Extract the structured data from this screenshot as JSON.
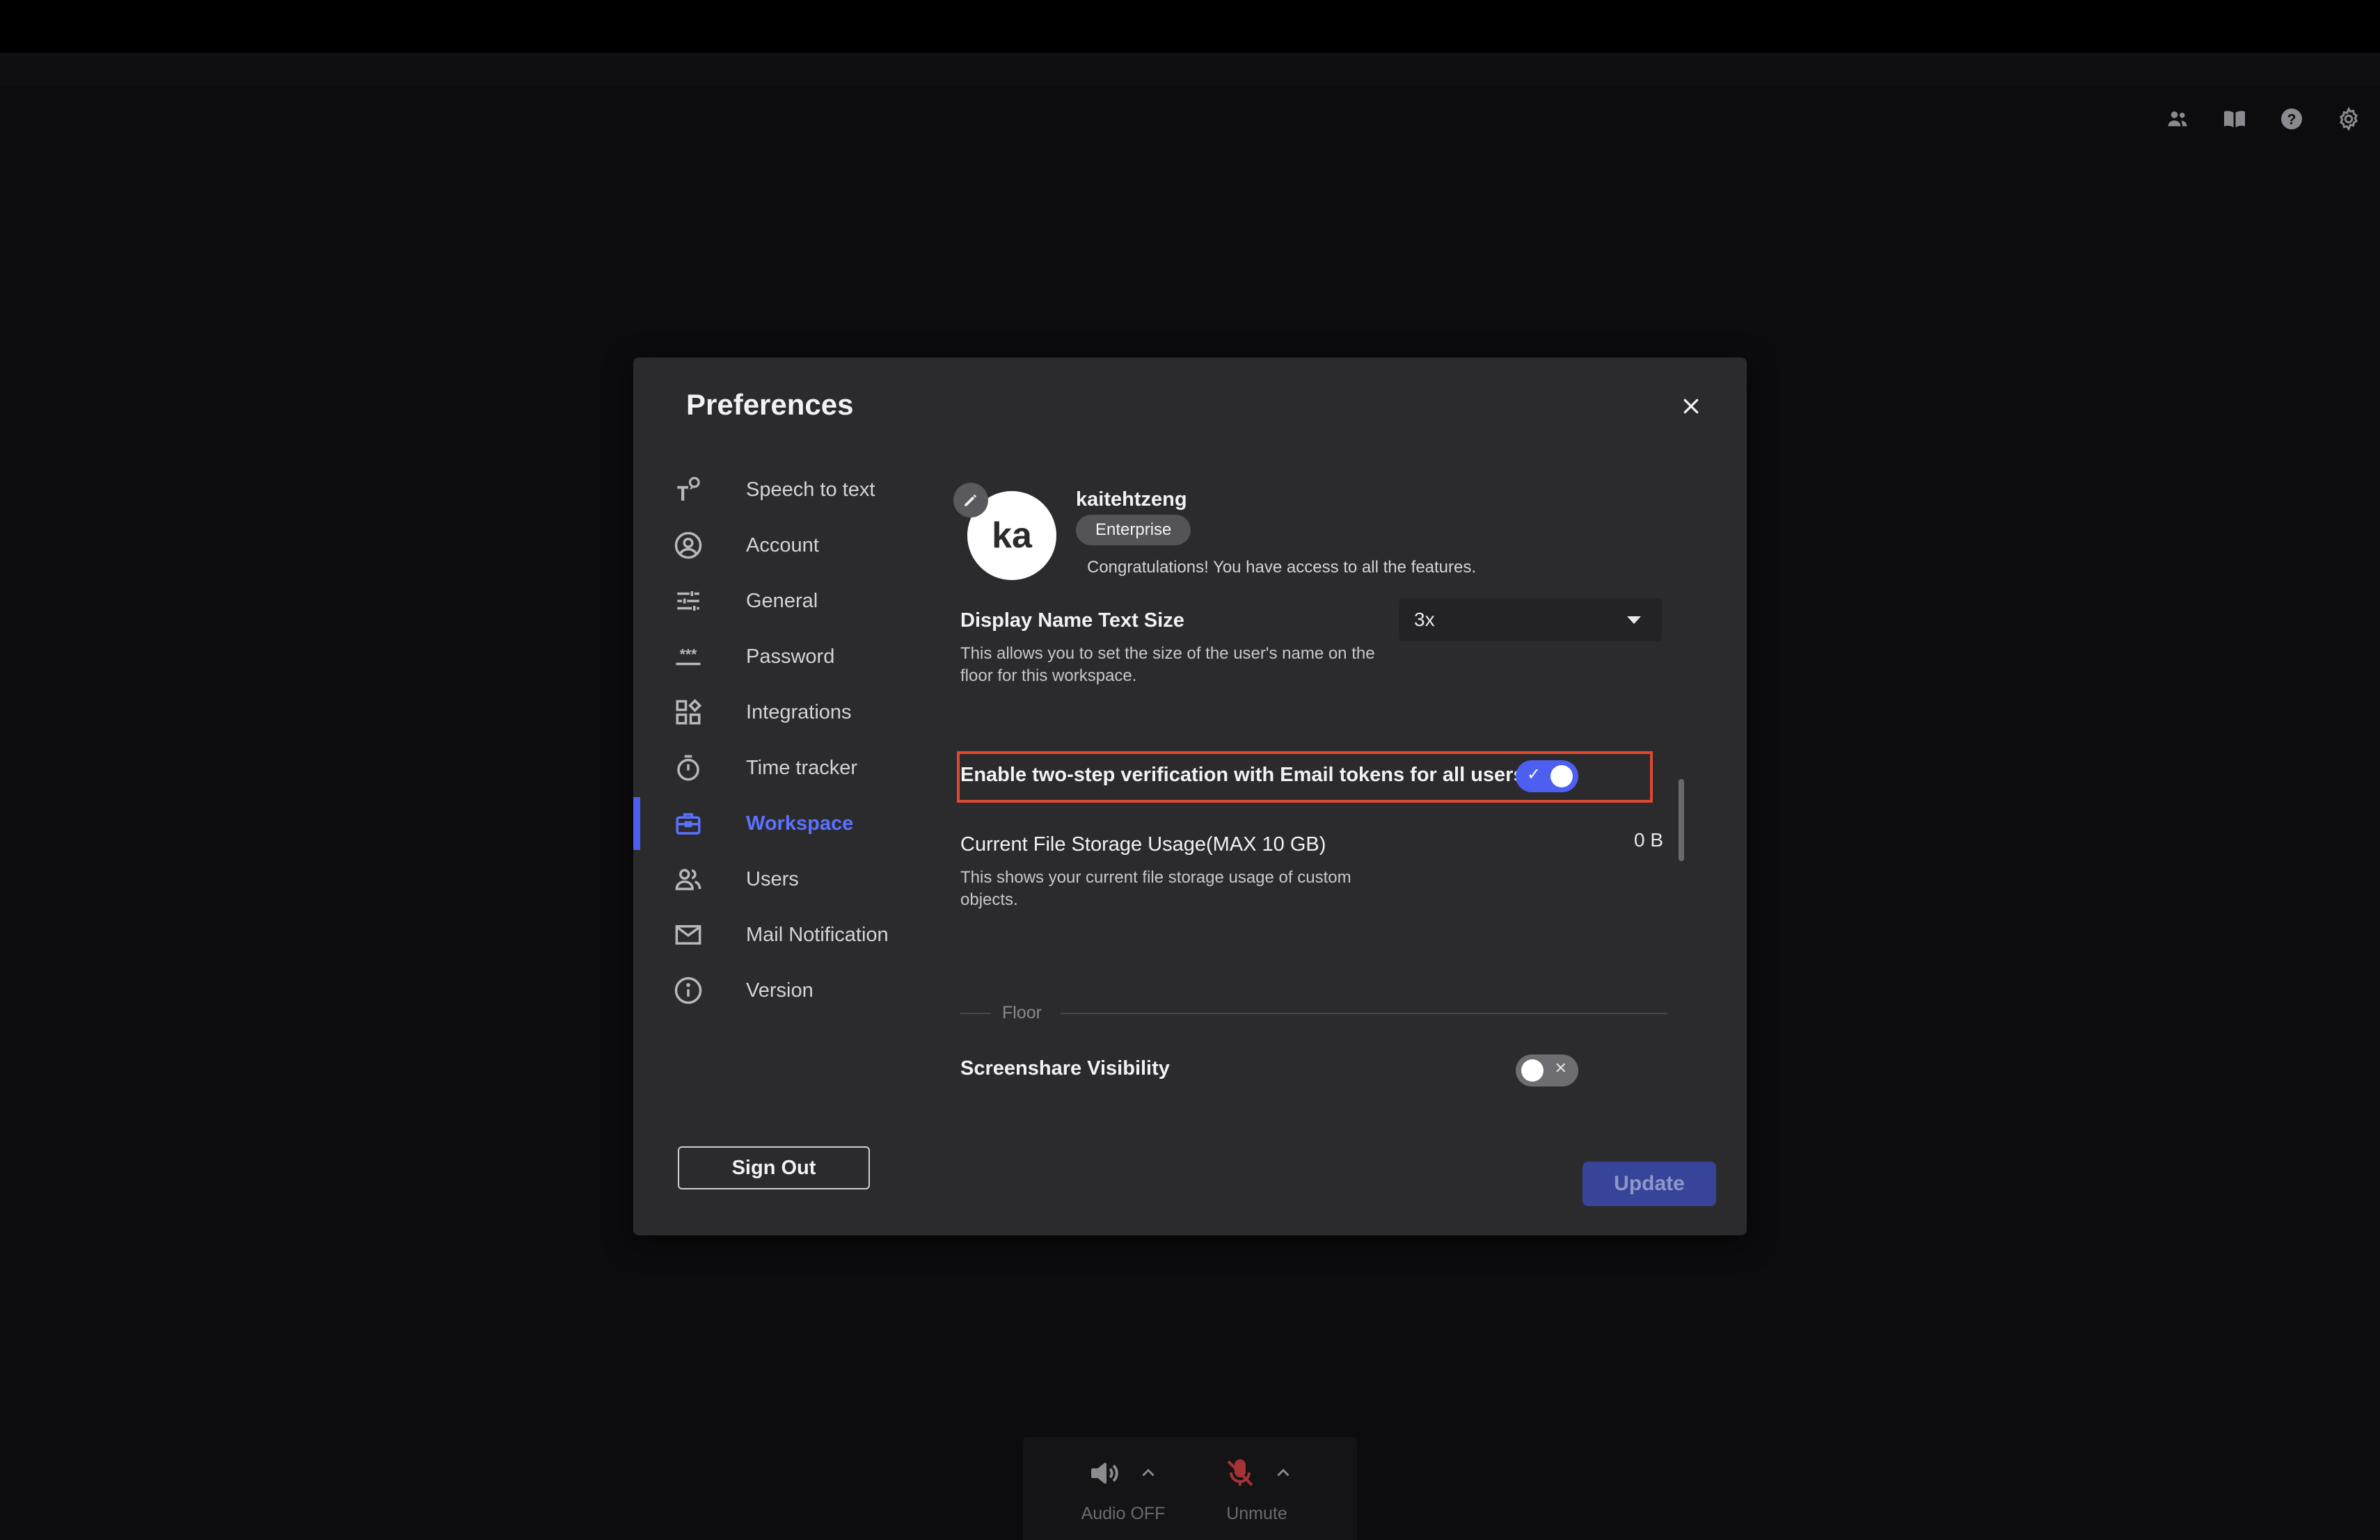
{
  "header": {
    "icons": [
      "users-icon",
      "book-icon",
      "help-icon",
      "settings-icon"
    ]
  },
  "modal": {
    "title": "Preferences",
    "nav": [
      {
        "label": "Speech to text",
        "icon": "speech-to-text-icon",
        "active": false
      },
      {
        "label": "Account",
        "icon": "account-icon",
        "active": false
      },
      {
        "label": "General",
        "icon": "sliders-icon",
        "active": false
      },
      {
        "label": "Password",
        "icon": "password-icon",
        "active": false
      },
      {
        "label": "Integrations",
        "icon": "integrations-icon",
        "active": false
      },
      {
        "label": "Time tracker",
        "icon": "timer-icon",
        "active": false
      },
      {
        "label": "Workspace",
        "icon": "briefcase-icon",
        "active": true
      },
      {
        "label": "Users",
        "icon": "users-icon",
        "active": false
      },
      {
        "label": "Mail Notification",
        "icon": "mail-icon",
        "active": false
      },
      {
        "label": "Version",
        "icon": "info-icon",
        "active": false
      }
    ],
    "signout_label": "Sign Out",
    "update_label": "Update",
    "profile": {
      "avatar_initials": "ka",
      "username": "kaitehtzeng",
      "plan": "Enterprise",
      "message": "Congratulations! You have access to all the features."
    },
    "display_name_size": {
      "title": "Display Name Text Size",
      "description_line1": "This allows you to set the size of the user's name on the",
      "description_line2": "floor for this workspace.",
      "selected": "3x"
    },
    "two_step": {
      "title": "Enable two-step verification with Email tokens for all users",
      "enabled": true,
      "on_mark": "✓"
    },
    "storage": {
      "title": "Current File Storage Usage(MAX 10 GB)",
      "description_line1": "This shows your current file storage usage of custom",
      "description_line2": "objects.",
      "value": "0 B"
    },
    "floor_section": {
      "label": "Floor"
    },
    "screenshare": {
      "title": "Screenshare Visibility",
      "enabled": false,
      "off_mark": "✕"
    }
  },
  "bottom_bar": {
    "audio_label": "Audio OFF",
    "mic_label": "Unmute"
  },
  "colors": {
    "accent": "#4c5ff0",
    "highlight": "#e0492e",
    "modal_bg": "#2b2b2d"
  }
}
